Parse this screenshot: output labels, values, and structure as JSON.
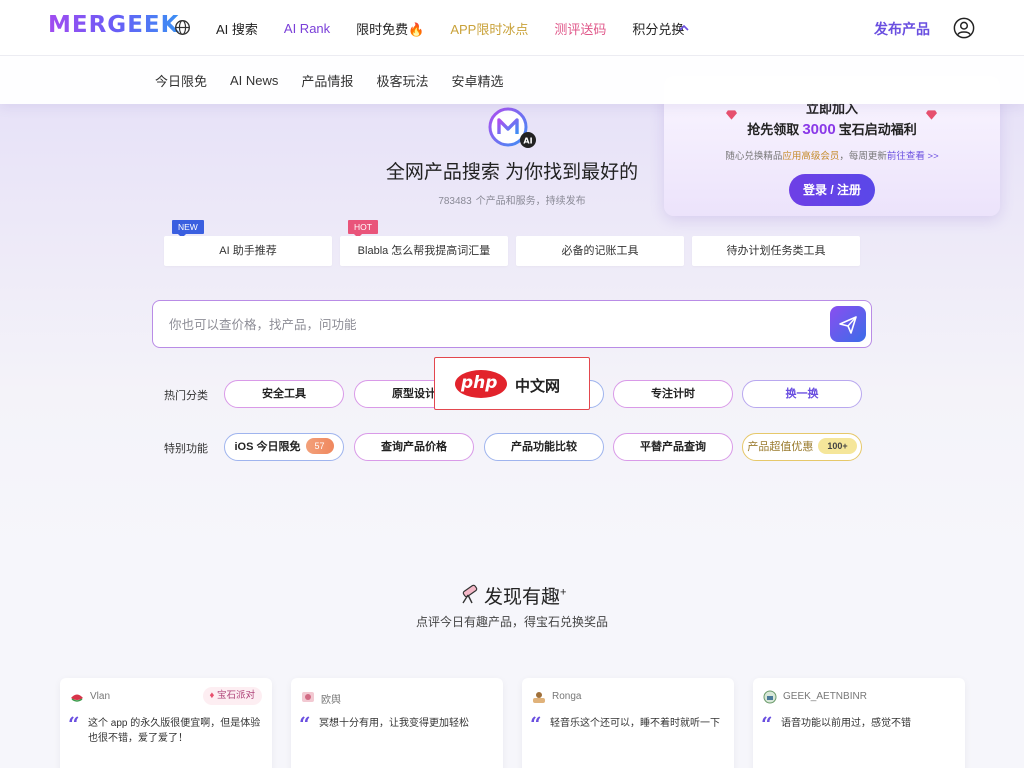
{
  "header": {
    "logo": "MERGEEK",
    "nav": [
      {
        "label": "AI 搜索",
        "color": "#222222"
      },
      {
        "label": "AI Rank",
        "color": "#7a3fd8"
      },
      {
        "label": "限时免费🔥",
        "color": "#222222"
      },
      {
        "label": "APP限时冰点",
        "color": "#c9a23a"
      },
      {
        "label": "测评送码",
        "color": "#e0588a"
      },
      {
        "label": "积分兑换",
        "color": "#222222"
      }
    ],
    "publish": "发布产品"
  },
  "subnav": [
    "今日限免",
    "AI News",
    "产品情报",
    "极客玩法",
    "安卓精选"
  ],
  "promo": {
    "join": "立即加入",
    "title_prefix": "抢先领取",
    "title_number": "3000",
    "title_suffix": "宝石启动福利",
    "sub_prefix": "随心兑换精品",
    "sub_highlight": "应用高级会员",
    "sub_middle": "，每周更新",
    "sub_link": "前往查看 >>",
    "login": "登录 / 注册"
  },
  "hero": {
    "title": "全网产品搜索 为你找到最好的",
    "count": "783483",
    "count_suffix": "个产品和服务，持续发布"
  },
  "suggestions": [
    {
      "label": "AI 助手推荐",
      "tag": "NEW"
    },
    {
      "label": "Blabla 怎么帮我提高词汇量",
      "tag": "HOT"
    },
    {
      "label": "必备的记账工具",
      "tag": ""
    },
    {
      "label": "待办计划任务类工具",
      "tag": ""
    }
  ],
  "search": {
    "placeholder": "你也可以查价格，找产品，问功能"
  },
  "hot_categories": {
    "label": "热门分类",
    "items": [
      "安全工具",
      "原型设计",
      "",
      "专注计时"
    ],
    "refresh": "换一换"
  },
  "special": {
    "label": "特别功能",
    "items": [
      {
        "label": "iOS 今日限免",
        "badge": "57"
      },
      {
        "label": "查询产品价格",
        "badge": ""
      },
      {
        "label": "产品功能比较",
        "badge": ""
      },
      {
        "label": "平替产品查询",
        "badge": ""
      },
      {
        "label": "产品超值优惠",
        "badge": "100+"
      }
    ]
  },
  "watermark": {
    "logo": "php",
    "text": "中文网"
  },
  "discover": {
    "title": "发现有趣",
    "sup": "+",
    "subtitle": "点评今日有趣产品，得宝石兑换奖品"
  },
  "reviews": [
    {
      "user": "Vlan",
      "tag": "宝石派对",
      "text": "这个 app 的永久版很便宜啊，但是体验也很不错，爱了爱了！"
    },
    {
      "user": "欧舆",
      "tag": "",
      "text": "冥想十分有用，让我变得更加轻松"
    },
    {
      "user": "Ronga",
      "tag": "",
      "text": "轻音乐这个还可以，睡不着时就听一下"
    },
    {
      "user": "GEEK_AETNBINR",
      "tag": "",
      "text": "语音功能以前用过，感觉不错"
    }
  ]
}
